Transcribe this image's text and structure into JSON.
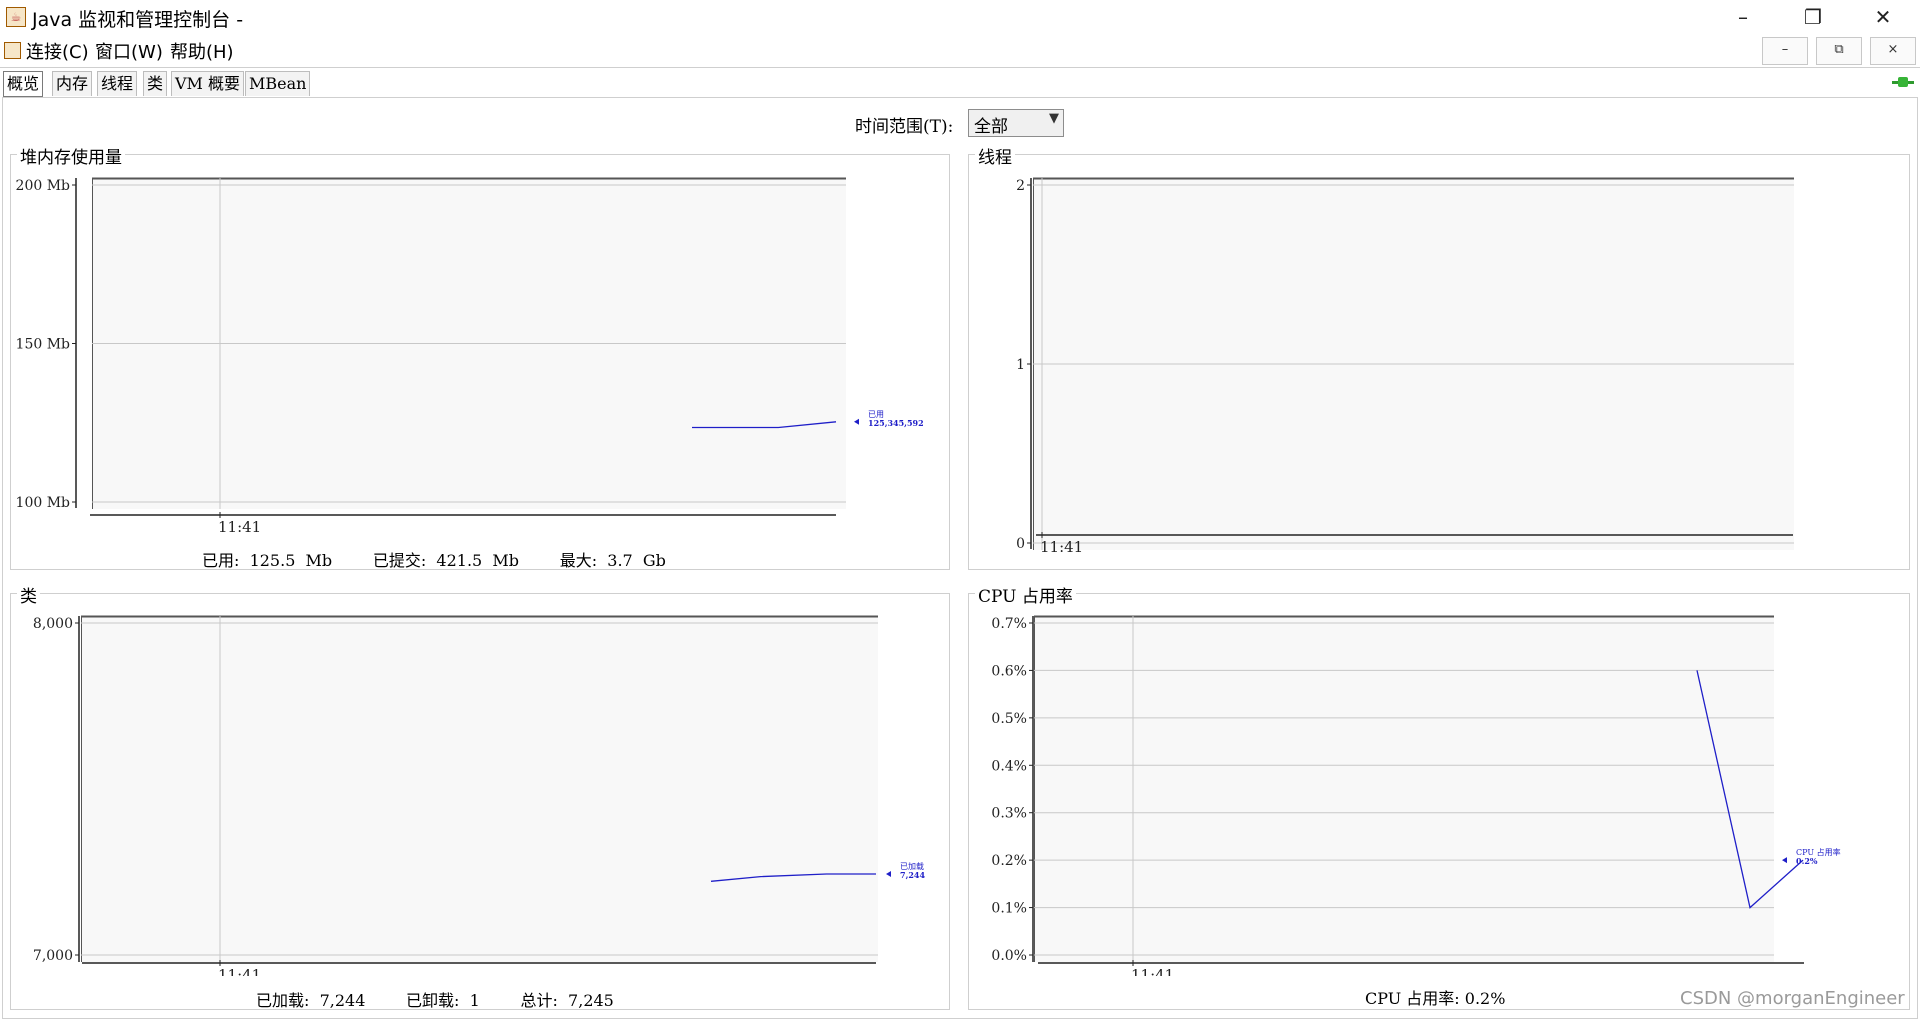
{
  "window": {
    "title": "Java 监视和管理控制台 -",
    "minimize": "–",
    "maximize": "❐",
    "close": "✕"
  },
  "menu": {
    "items": [
      "连接(C)",
      "窗口(W)",
      "帮助(H)"
    ],
    "mdi": [
      "–",
      "⧉",
      "×"
    ]
  },
  "tabs": [
    "概览",
    "内存",
    "线程",
    "类",
    "VM 概要",
    "MBean"
  ],
  "time_range": {
    "label": "时间范围(T):",
    "value": "全部"
  },
  "panels": {
    "heap": {
      "title": "堆内存使用量",
      "summary": "已用:  125.5  Mb        已提交:  421.5  Mb        最大:  3.7  Gb"
    },
    "threads": {
      "title": "线程"
    },
    "classes": {
      "title": "类",
      "summary": "已加载:  7,244        已卸载:  1        总计:  7,245"
    },
    "cpu": {
      "title": "CPU 占用率",
      "summary": "CPU 占用率: 0.2%"
    }
  },
  "chart_data": [
    {
      "type": "line",
      "title": "堆内存使用量",
      "yticks": [
        "100 Mb",
        "150 Mb",
        "200 Mb"
      ],
      "ylim": [
        100,
        200
      ],
      "xticks": [
        "11:41"
      ],
      "series": [
        {
          "name": "已用",
          "label": "125,345,592",
          "color": "#1f1fc8",
          "points": [
            [
              0.0,
              123.5
            ],
            [
              0.6,
              123.5
            ],
            [
              1.0,
              125.3
            ]
          ]
        }
      ]
    },
    {
      "type": "line",
      "title": "线程",
      "yticks": [
        "0",
        "1",
        "2"
      ],
      "ylim": [
        0,
        2
      ],
      "xticks": [
        "11:41"
      ],
      "series": []
    },
    {
      "type": "line",
      "title": "类",
      "yticks": [
        "7,000",
        "8,000"
      ],
      "ylim": [
        7000,
        8000
      ],
      "xticks": [
        "11:41"
      ],
      "series": [
        {
          "name": "已加载",
          "label": "7,244",
          "color": "#1f1fc8",
          "points": [
            [
              0.0,
              7222
            ],
            [
              0.3,
              7236
            ],
            [
              0.7,
              7244
            ],
            [
              1.0,
              7244
            ]
          ]
        }
      ]
    },
    {
      "type": "line",
      "title": "CPU 占用率",
      "yticks": [
        "0.0%",
        "0.1%",
        "0.2%",
        "0.3%",
        "0.4%",
        "0.5%",
        "0.6%",
        "0.7%"
      ],
      "ylim": [
        0.0,
        0.7
      ],
      "xticks": [
        "11:41"
      ],
      "series": [
        {
          "name": "CPU 占用率",
          "label": "0.2%",
          "color": "#1f1fc8",
          "points": [
            [
              0.0,
              0.6
            ],
            [
              0.5,
              0.1
            ],
            [
              1.0,
              0.2
            ]
          ]
        }
      ]
    }
  ],
  "watermark": "CSDN @morganEngineer"
}
